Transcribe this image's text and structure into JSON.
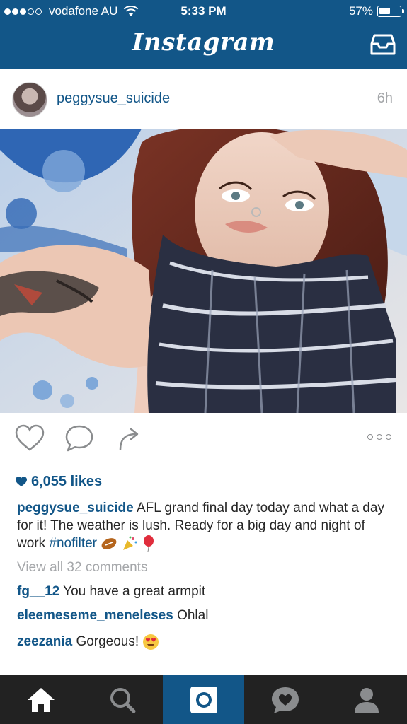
{
  "status_bar": {
    "carrier": "vodafone AU",
    "time": "5:33 PM",
    "battery": "57%",
    "battery_level": 0.57,
    "signal_bars": 3
  },
  "header": {
    "title": "Instagram"
  },
  "post": {
    "username": "peggysue_suicide",
    "time_ago": "6h",
    "likes": "6,055 likes",
    "caption_user": "peggysue_suicide",
    "caption_text": "AFL grand final day today and what a day for it! The weather is lush. Ready for a big day and night of work",
    "caption_tag": "#nofilter",
    "view_all": "View all 32 comments",
    "comments": [
      {
        "user": "fg__12",
        "text": "You have a great armpit"
      },
      {
        "user": "eleemeseme_meneleses",
        "text": "Ohlal"
      },
      {
        "user": "zeezania",
        "text": "Gorgeous!"
      }
    ]
  },
  "colors": {
    "brand": "#125688",
    "tab_bar": "#222222",
    "muted": "#a5a7aa"
  },
  "tab_bar": {
    "tabs": [
      {
        "icon": "home-icon",
        "active": false
      },
      {
        "icon": "search-icon",
        "active": false
      },
      {
        "icon": "camera-icon",
        "active": true
      },
      {
        "icon": "activity-icon",
        "active": false
      },
      {
        "icon": "profile-icon",
        "active": false
      }
    ]
  }
}
